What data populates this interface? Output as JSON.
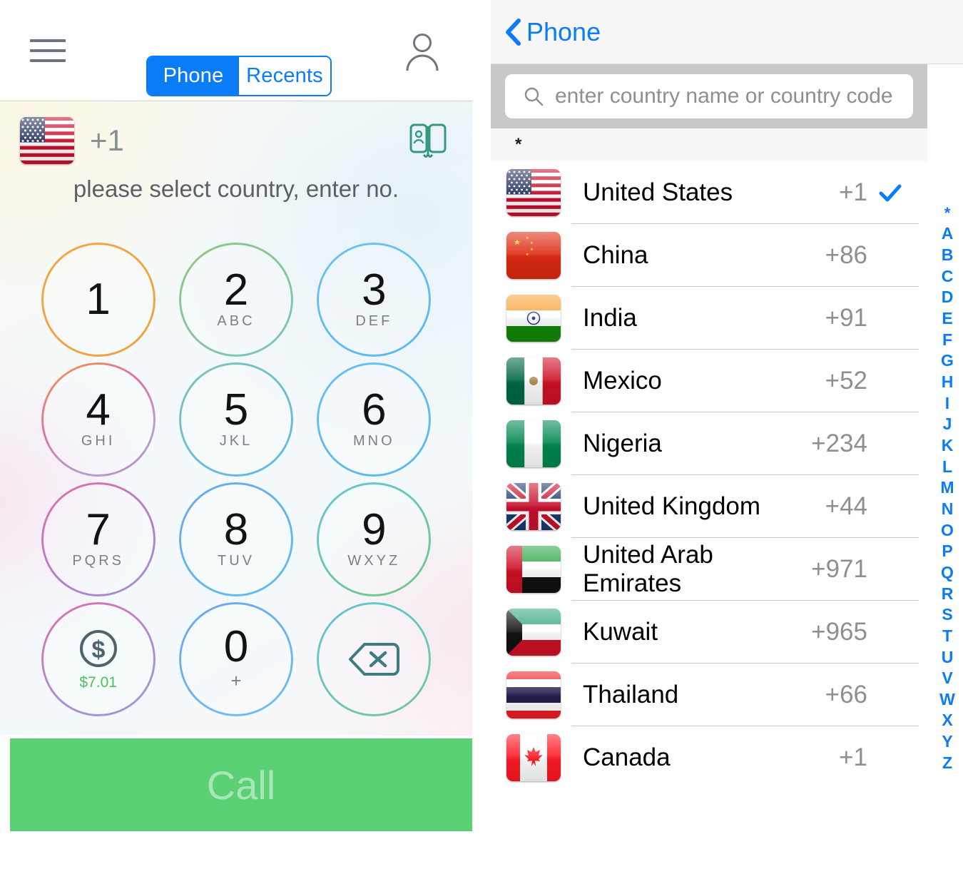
{
  "left": {
    "menu_icon": "hamburger-icon",
    "tabs": [
      {
        "label": "Phone",
        "active": true
      },
      {
        "label": "Recents",
        "active": false
      }
    ],
    "profile_icon": "person-icon",
    "selected_country_flag": "us-flag",
    "dial_code": "+1",
    "contacts_icon": "address-book-icon",
    "hint": "please select country, enter no.",
    "keys": [
      {
        "digit": "1",
        "letters": ""
      },
      {
        "digit": "2",
        "letters": "ABC"
      },
      {
        "digit": "3",
        "letters": "DEF"
      },
      {
        "digit": "4",
        "letters": "GHI"
      },
      {
        "digit": "5",
        "letters": "JKL"
      },
      {
        "digit": "6",
        "letters": "MNO"
      },
      {
        "digit": "7",
        "letters": "PQRS"
      },
      {
        "digit": "8",
        "letters": "TUV"
      },
      {
        "digit": "9",
        "letters": "WXYZ"
      }
    ],
    "balance_key": {
      "icon": "dollar-circle-icon",
      "balance": "$7.01"
    },
    "zero_key": {
      "digit": "0",
      "sub": "+"
    },
    "delete_key": {
      "icon": "backspace-icon"
    },
    "call_label": "Call",
    "colors": {
      "accent_blue": "#0a7cf7",
      "call_green": "#5bd075",
      "call_text_green": "#a9e6b7",
      "balance_green": "#4cc15e"
    }
  },
  "right": {
    "back_label": "Phone",
    "back_icon": "chevron-left-icon",
    "search": {
      "icon": "search-icon",
      "placeholder": "enter country name or country code",
      "value": ""
    },
    "section_header": "*",
    "countries": [
      {
        "name": "United States",
        "code": "+1",
        "flag": "us-flag",
        "selected": true
      },
      {
        "name": "China",
        "code": "+86",
        "flag": "cn-flag",
        "selected": false
      },
      {
        "name": "India",
        "code": "+91",
        "flag": "in-flag",
        "selected": false
      },
      {
        "name": "Mexico",
        "code": "+52",
        "flag": "mx-flag",
        "selected": false
      },
      {
        "name": "Nigeria",
        "code": "+234",
        "flag": "ng-flag",
        "selected": false
      },
      {
        "name": "United Kingdom",
        "code": "+44",
        "flag": "gb-flag",
        "selected": false
      },
      {
        "name": "United Arab Emirates",
        "code": "+971",
        "flag": "ae-flag",
        "selected": false
      },
      {
        "name": "Kuwait",
        "code": "+965",
        "flag": "kw-flag",
        "selected": false
      },
      {
        "name": "Thailand",
        "code": "+66",
        "flag": "th-flag",
        "selected": false
      },
      {
        "name": "Canada",
        "code": "+1",
        "flag": "ca-flag",
        "selected": false
      }
    ],
    "alpha_index": [
      "*",
      "A",
      "B",
      "C",
      "D",
      "E",
      "F",
      "G",
      "H",
      "I",
      "J",
      "K",
      "L",
      "M",
      "N",
      "O",
      "P",
      "Q",
      "R",
      "S",
      "T",
      "U",
      "V",
      "W",
      "X",
      "Y",
      "Z"
    ],
    "colors": {
      "accent_blue": "#0a7cf7",
      "search_bg": "#c8c8c8",
      "navbar_bg": "#f7f7f7"
    }
  }
}
